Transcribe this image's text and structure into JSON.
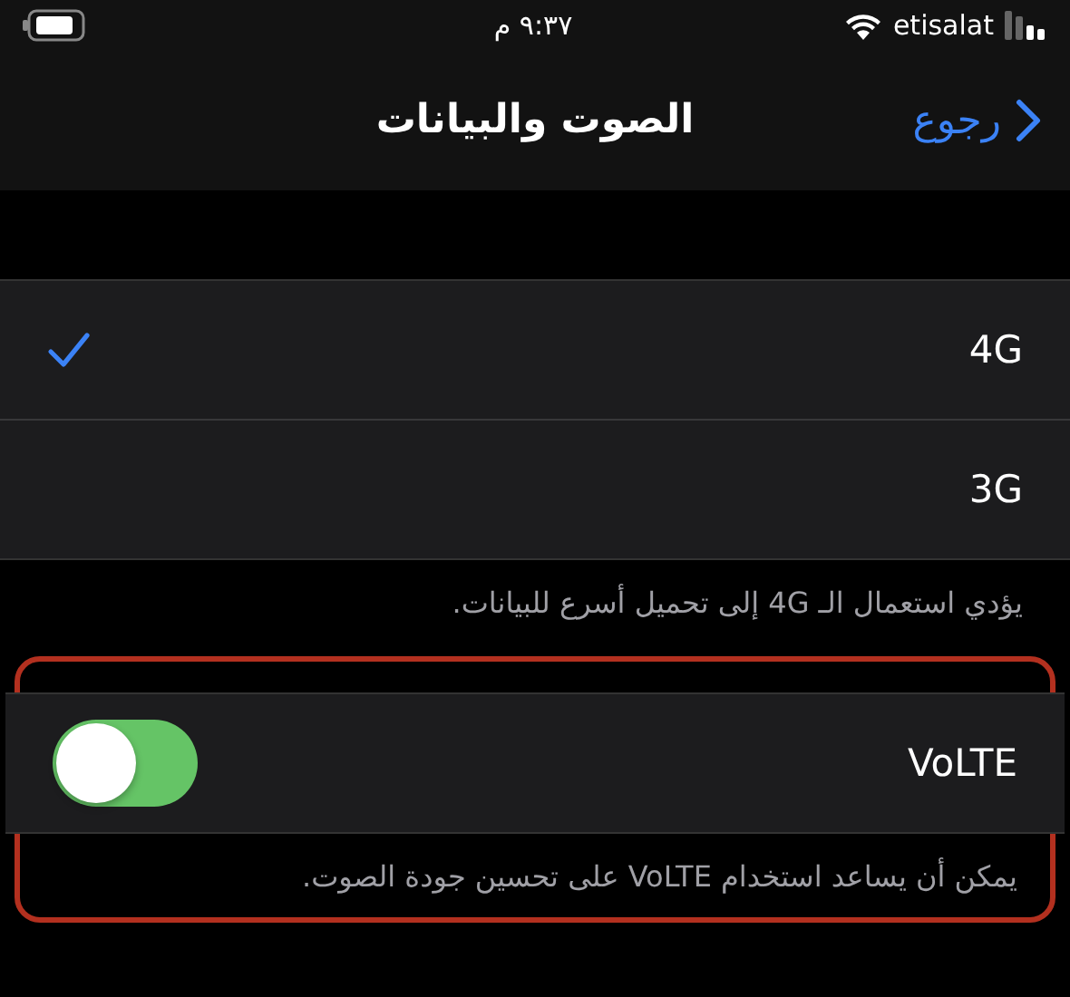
{
  "status_bar": {
    "time": "٩:٣٧ م",
    "carrier": "etisalat"
  },
  "nav": {
    "back": "رجوع",
    "title": "الصوت والبيانات"
  },
  "network_options": [
    {
      "label": "4G",
      "selected": true
    },
    {
      "label": "3G",
      "selected": false
    }
  ],
  "network_footer": "يؤدي استعمال الـ 4G إلى تحميل أسرع للبيانات.",
  "volte": {
    "label": "VoLTE",
    "on": true,
    "footer": "يمكن أن يساعد استخدام VoLTE على تحسين جودة الصوت."
  }
}
